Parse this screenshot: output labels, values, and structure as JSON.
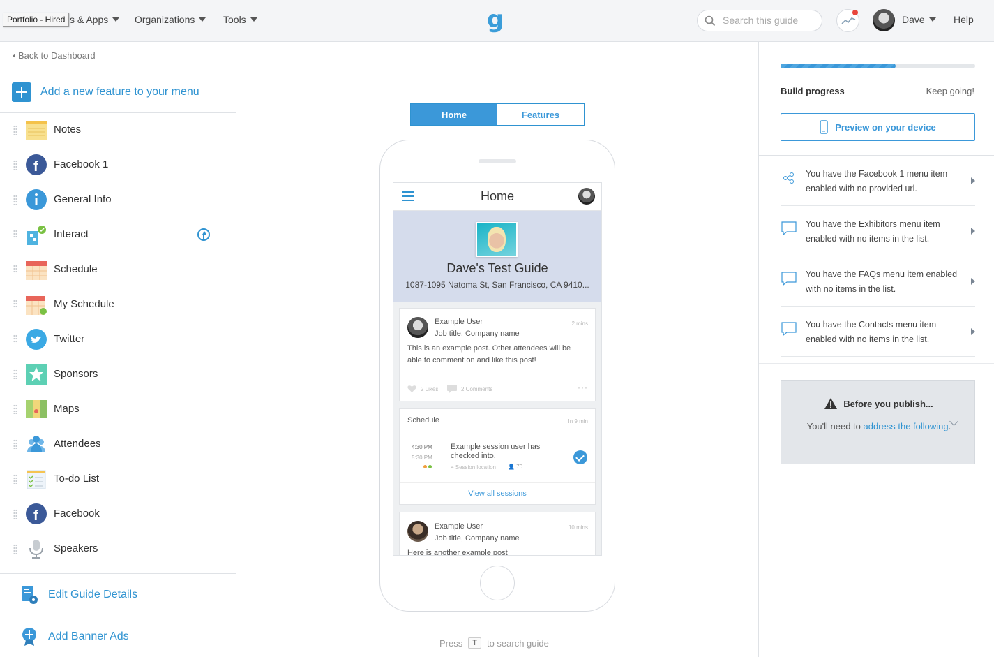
{
  "topbar": {
    "tooltip": "Portfolio - Hired",
    "nav_apps": "s & Apps",
    "nav_orgs": "Organizations",
    "nav_tools": "Tools",
    "logo": "g",
    "search_placeholder": "Search this guide",
    "user_name": "Dave",
    "help": "Help"
  },
  "sidebar": {
    "back": "Back to Dashboard",
    "add_feature": "Add a new feature to your menu",
    "items": [
      {
        "label": "Notes",
        "icon": "notes-icon"
      },
      {
        "label": "Facebook 1",
        "icon": "facebook-icon"
      },
      {
        "label": "General Info",
        "icon": "info-icon"
      },
      {
        "label": "Interact",
        "icon": "interact-icon"
      },
      {
        "label": "Schedule",
        "icon": "calendar-icon"
      },
      {
        "label": "My Schedule",
        "icon": "calendar-check-icon"
      },
      {
        "label": "Twitter",
        "icon": "twitter-icon"
      },
      {
        "label": "Sponsors",
        "icon": "star-icon"
      },
      {
        "label": "Maps",
        "icon": "map-icon"
      },
      {
        "label": "Attendees",
        "icon": "people-icon"
      },
      {
        "label": "To-do List",
        "icon": "checklist-icon"
      },
      {
        "label": "Facebook",
        "icon": "facebook-icon"
      },
      {
        "label": "Speakers",
        "icon": "microphone-icon"
      }
    ],
    "edit_guide": "Edit Guide Details",
    "add_banner": "Add Banner Ads"
  },
  "preview": {
    "tab_home": "Home",
    "tab_features": "Features",
    "screen_title": "Home",
    "guide_name": "Dave's Test Guide",
    "guide_address": "1087-1095 Natoma St, San Francisco, CA 9410...",
    "post1": {
      "user": "Example User",
      "subtitle": "Job title, Company name",
      "time": "2 mins",
      "text": "This is an example post. Other attendees will be able to comment on and like this post!",
      "likes": "2 Likes",
      "comments": "2 Comments"
    },
    "schedule": {
      "title": "Schedule",
      "time_hint": "In 9 min",
      "start": "4:30 PM",
      "end": "5:30 PM",
      "session": "Example session user has checked into.",
      "location": "Session location",
      "count": "70",
      "view_all": "View all sessions"
    },
    "post2": {
      "user": "Example User",
      "subtitle": "Job title, Company name",
      "time": "10 mins",
      "text": "Here is another example post"
    },
    "press_a": "Press",
    "press_key": "T",
    "press_b": "to search guide"
  },
  "right": {
    "progress": 0.59,
    "build_progress": "Build progress",
    "keep_going": "Keep going!",
    "preview_device": "Preview on your device",
    "notices": [
      "You have the Facebook 1 menu item enabled with no provided url.",
      "You have the Exhibitors menu item enabled with no items in the list.",
      "You have the FAQs menu item enabled with no items in the list.",
      "You have the Contacts menu item enabled with no items in the list."
    ],
    "publish_title": "Before you publish...",
    "publish_text_a": "You'll need to ",
    "publish_link": "address the following",
    "publish_text_b": "."
  }
}
